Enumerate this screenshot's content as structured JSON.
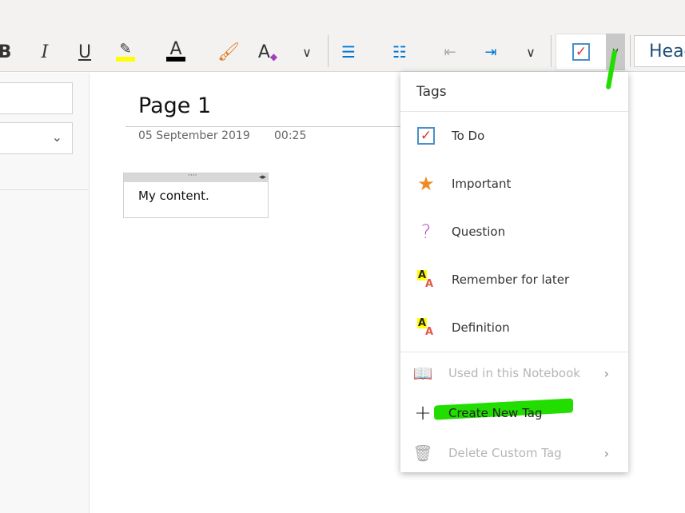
{
  "toolbar": {
    "bold": "B",
    "italic": "I",
    "underline": "U",
    "font_color": "A",
    "styles": "A",
    "more": "⌄",
    "heading_style": "Head",
    "highlight_color": "#ffff00",
    "font_color_value": "#000000"
  },
  "page": {
    "title": "Page 1",
    "date": "05 September 2019",
    "time": "00:25",
    "content": "My content.",
    "handle": "····"
  },
  "tags_menu": {
    "title": "Tags",
    "items": [
      {
        "label": "To Do",
        "icon": "checkbox-icon"
      },
      {
        "label": "Important",
        "icon": "star-icon"
      },
      {
        "label": "Question",
        "icon": "question-icon"
      },
      {
        "label": "Remember for later",
        "icon": "highlight-aa-icon"
      },
      {
        "label": "Definition",
        "icon": "highlight-aa-icon"
      }
    ],
    "used_in_notebook": "Used in this Notebook",
    "create_new_tag": "Create New Tag",
    "delete_custom_tag": "Delete Custom Tag"
  },
  "colors": {
    "annotation": "#22dd00",
    "accent": "#0078d4"
  }
}
